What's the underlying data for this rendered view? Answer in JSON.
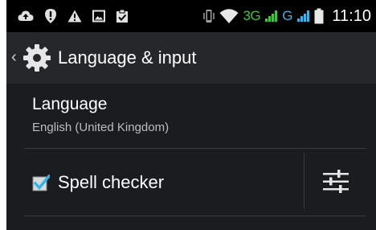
{
  "statusbar": {
    "left_icons": [
      "cloud-upload-icon",
      "alert-bubble-icon",
      "warning-icon",
      "gallery-icon",
      "clipboard-check-icon"
    ],
    "right_icons": [
      "vibrate-icon",
      "wifi-icon",
      "signal-icon",
      "battery-icon"
    ],
    "network_1": "3G",
    "network_2": "G",
    "time": "11:10",
    "colors": {
      "net_3g": "#3cc63c",
      "net_g": "#33b5e5"
    }
  },
  "actionbar": {
    "title": "Language & input",
    "icon": "settings-gear-icon"
  },
  "list": {
    "language": {
      "title": "Language",
      "summary": "English (United Kingdom)"
    },
    "spell_checker": {
      "label": "Spell checker",
      "checked": true,
      "settings_icon": "sliders-icon"
    }
  },
  "colors": {
    "accent": "#33b5e5",
    "background": "#1b1c1f",
    "actionbar": "#26272b"
  }
}
